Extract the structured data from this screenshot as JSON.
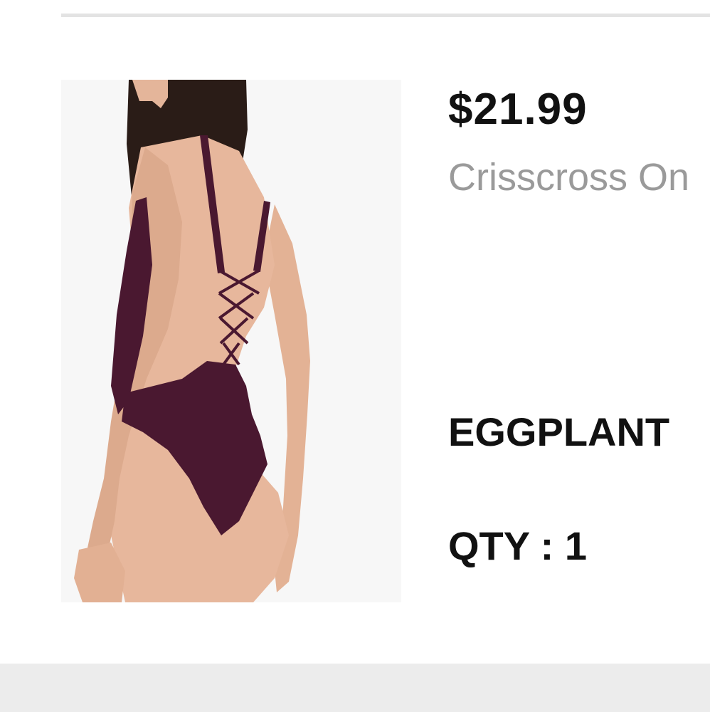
{
  "cart_item": {
    "price": "$21.99",
    "name": "Crisscross On",
    "color": "EGGPLANT",
    "qty_label": "QTY : ",
    "qty_value": "1",
    "image": {
      "swimsuit_color": "#4a1830",
      "skin_color": "#e7b79c",
      "hair_color": "#2a1c17"
    }
  }
}
